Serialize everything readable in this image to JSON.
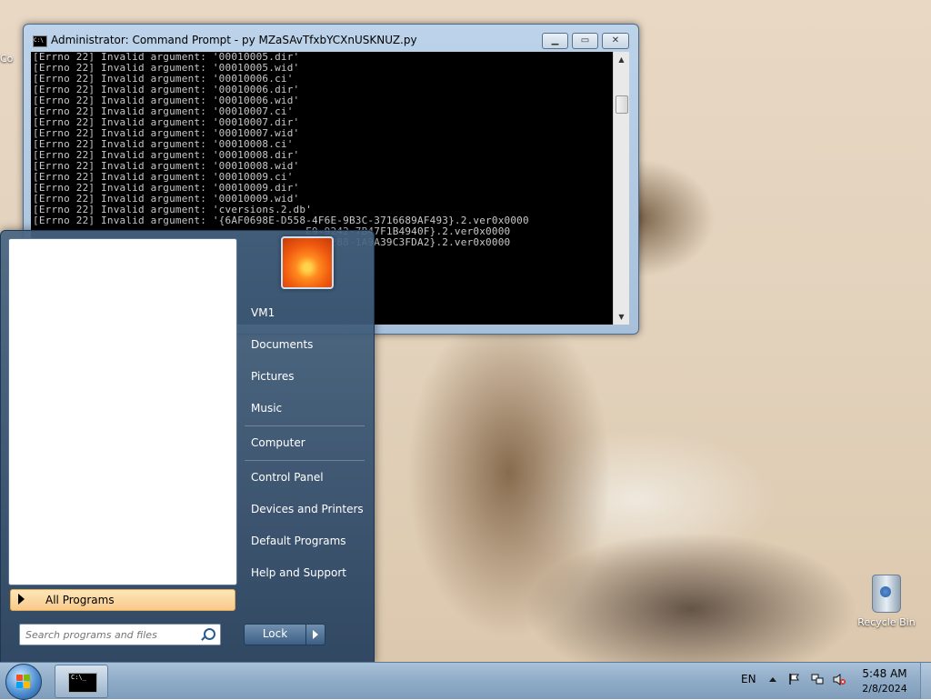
{
  "cmd_window": {
    "title": "Administrator: Command Prompt - py  MZaSAvTfxbYCXnUSKNUZ.py",
    "icon": "cmd-icon",
    "lines": [
      "[Errno 22] Invalid argument: '00010005.dir'",
      "[Errno 22] Invalid argument: '00010005.wid'",
      "[Errno 22] Invalid argument: '00010006.ci'",
      "[Errno 22] Invalid argument: '00010006.dir'",
      "[Errno 22] Invalid argument: '00010006.wid'",
      "[Errno 22] Invalid argument: '00010007.ci'",
      "[Errno 22] Invalid argument: '00010007.dir'",
      "[Errno 22] Invalid argument: '00010007.wid'",
      "[Errno 22] Invalid argument: '00010008.ci'",
      "[Errno 22] Invalid argument: '00010008.dir'",
      "[Errno 22] Invalid argument: '00010008.wid'",
      "[Errno 22] Invalid argument: '00010009.ci'",
      "[Errno 22] Invalid argument: '00010009.dir'",
      "[Errno 22] Invalid argument: '00010009.wid'",
      "[Errno 22] Invalid argument: 'cversions.2.db'",
      "[Errno 22] Invalid argument: '{6AF0698E-D558-4F6E-9B3C-3716689AF493}.2.ver0x0000",
      "",
      "                                            E9-9242-7B47F1B4940F}.2.ver0x0000",
      "",
      "                                            6D-8288-1A9A39C3FDA2}.2.ver0x0000"
    ]
  },
  "start_menu": {
    "all_programs_label": "All Programs",
    "search_placeholder": "Search programs and files",
    "right_items": {
      "user": "VM1",
      "documents": "Documents",
      "pictures": "Pictures",
      "music": "Music",
      "computer": "Computer",
      "control_panel": "Control Panel",
      "devices": "Devices and Printers",
      "default_programs": "Default Programs",
      "help": "Help and Support"
    },
    "lock_label": "Lock"
  },
  "desktop": {
    "recycle_bin_label": "Recycle Bin",
    "left_icon_label": "Co"
  },
  "taskbar": {
    "language": "EN",
    "time": "5:48 AM",
    "date": "2/8/2024"
  }
}
